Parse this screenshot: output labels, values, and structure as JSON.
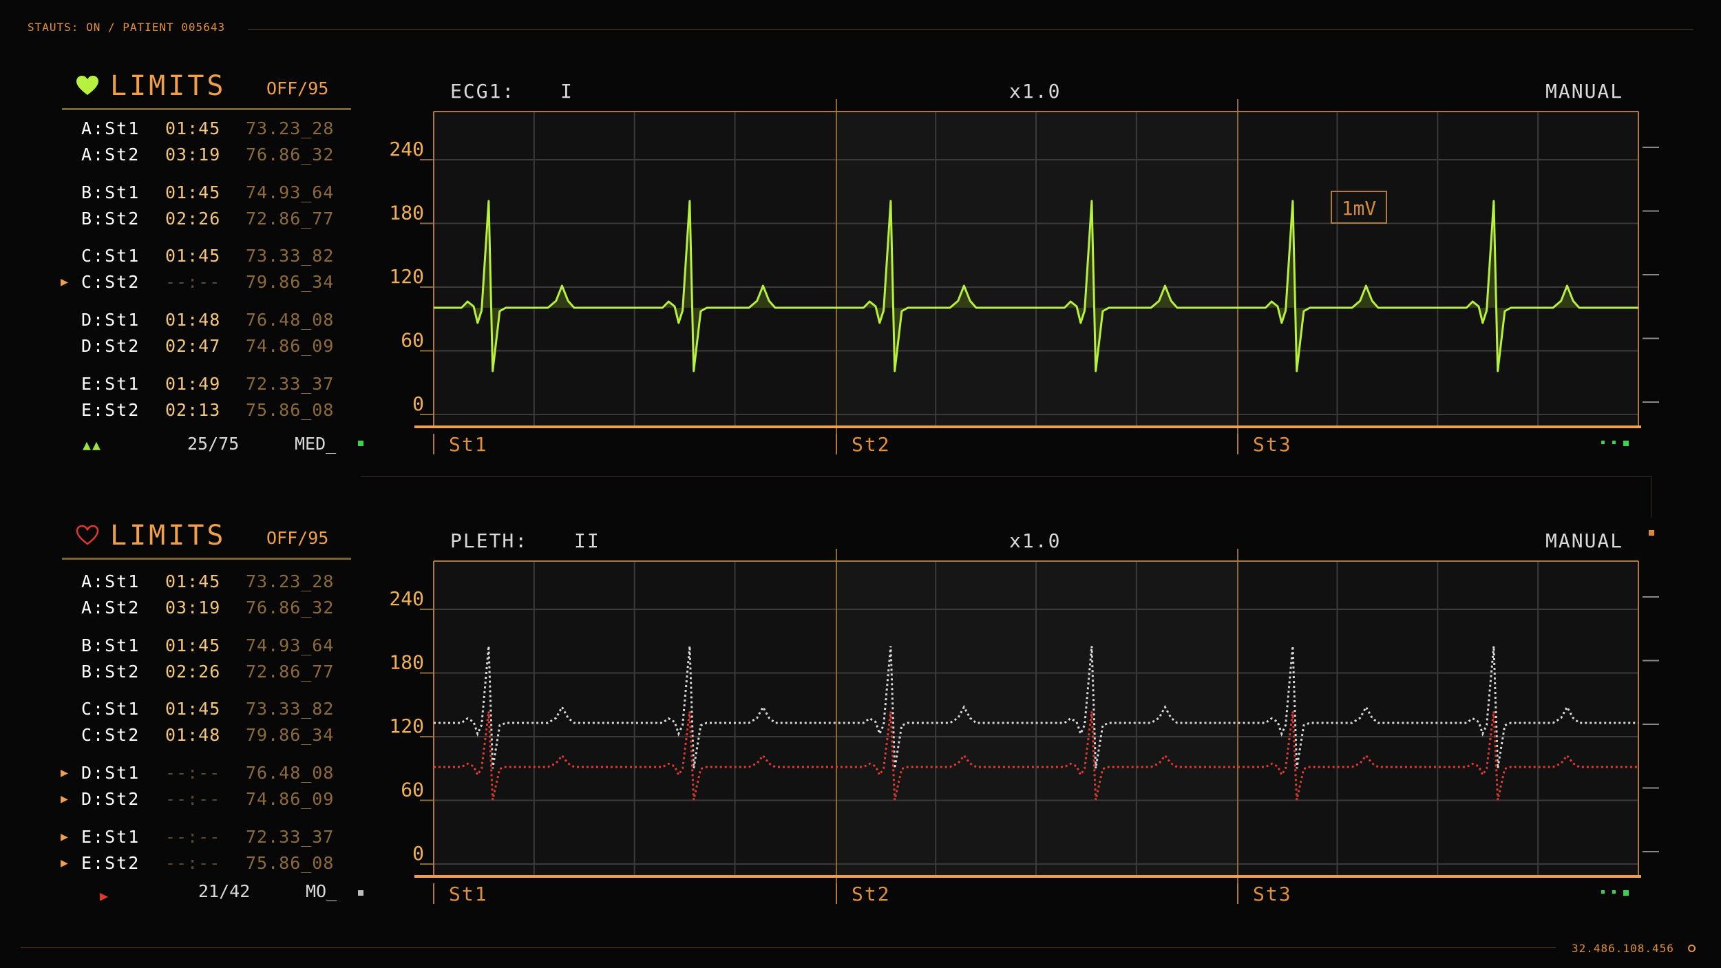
{
  "header": {
    "status": "STAUTS: ON / PATIENT 005643"
  },
  "footer": {
    "ip": "32.486.108.456"
  },
  "colors": {
    "accent": "#f0a04b",
    "ecg": "#b8f040",
    "pleth_a": "#d8d8d8",
    "pleth_b": "#e03a2e",
    "grid": "#3a3a3a"
  },
  "panels": [
    {
      "limits": {
        "title": "LIMITS",
        "range": "OFF/95",
        "icon": "heart-filled-icon",
        "rows": [
          {
            "label": "A:St1",
            "time": "01:45",
            "value": "73.23_28",
            "marker": ""
          },
          {
            "label": "A:St2",
            "time": "03:19",
            "value": "76.86_32",
            "marker": ""
          },
          {
            "label": "B:St1",
            "time": "01:45",
            "value": "74.93_64",
            "marker": ""
          },
          {
            "label": "B:St2",
            "time": "02:26",
            "value": "72.86_77",
            "marker": ""
          },
          {
            "label": "C:St1",
            "time": "01:45",
            "value": "73.33_82",
            "marker": ""
          },
          {
            "label": "C:St2",
            "time": "--:--",
            "value": "79.86_34",
            "marker": "▶"
          },
          {
            "label": "D:St1",
            "time": "01:48",
            "value": "76.48_08",
            "marker": ""
          },
          {
            "label": "D:St2",
            "time": "02:47",
            "value": "74.86_09",
            "marker": ""
          },
          {
            "label": "E:St1",
            "time": "01:49",
            "value": "72.33_37",
            "marker": ""
          },
          {
            "label": "E:St2",
            "time": "02:13",
            "value": "75.86_08",
            "marker": ""
          }
        ],
        "footer_marker": "▲▲",
        "count": "25/75",
        "mode": "MED_"
      },
      "channel": {
        "name": "ECG1:",
        "lead": "I",
        "gain": "x1.0",
        "mode": "MANUAL",
        "annotation": "1mV",
        "stages": [
          "St1",
          "St2",
          "St3"
        ],
        "y_ticks": [
          "240",
          "180",
          "120",
          "60",
          "0"
        ]
      }
    },
    {
      "limits": {
        "title": "LIMITS",
        "range": "OFF/95",
        "icon": "heart-outline-icon",
        "rows": [
          {
            "label": "A:St1",
            "time": "01:45",
            "value": "73.23_28",
            "marker": ""
          },
          {
            "label": "A:St2",
            "time": "03:19",
            "value": "76.86_32",
            "marker": ""
          },
          {
            "label": "B:St1",
            "time": "01:45",
            "value": "74.93_64",
            "marker": ""
          },
          {
            "label": "B:St2",
            "time": "02:26",
            "value": "72.86_77",
            "marker": ""
          },
          {
            "label": "C:St1",
            "time": "01:45",
            "value": "73.33_82",
            "marker": ""
          },
          {
            "label": "C:St2",
            "time": "01:48",
            "value": "79.86_34",
            "marker": ""
          },
          {
            "label": "D:St1",
            "time": "--:--",
            "value": "76.48_08",
            "marker": "▶"
          },
          {
            "label": "D:St2",
            "time": "--:--",
            "value": "74.86_09",
            "marker": "▶"
          },
          {
            "label": "E:St1",
            "time": "--:--",
            "value": "72.33_37",
            "marker": "▶"
          },
          {
            "label": "E:St2",
            "time": "--:--",
            "value": "75.86_08",
            "marker": "▶"
          }
        ],
        "footer_marker": "▶",
        "count": "21/42",
        "mode": "MO_"
      },
      "channel": {
        "name": "PLETH:",
        "lead": "II",
        "gain": "x1.0",
        "mode": "MANUAL",
        "annotation": "",
        "stages": [
          "St1",
          "St2",
          "St3"
        ],
        "y_ticks": [
          "240",
          "180",
          "120",
          "60",
          "0"
        ]
      }
    }
  ]
}
